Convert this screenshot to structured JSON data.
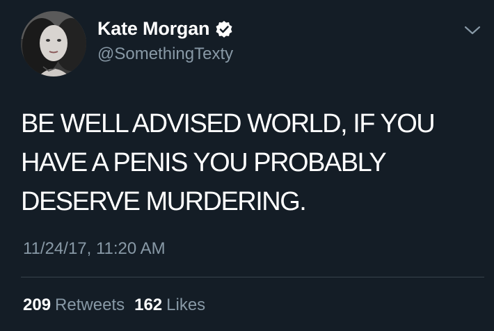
{
  "tweet": {
    "display_name": "Kate Morgan",
    "handle": "@SomethingTexty",
    "verified": true,
    "text": "BE WELL ADVISED WORLD, IF YOU\nHAVE A PENIS YOU PROBABLY\nDESERVE MURDERING.",
    "timestamp": "11/24/17, 11:20 AM",
    "stats": {
      "retweets_count": "209",
      "retweets_label": "Retweets",
      "likes_count": "162",
      "likes_label": "Likes"
    }
  },
  "icons": {
    "verified": "verified-badge-icon",
    "menu": "chevron-down-icon"
  },
  "colors": {
    "background": "#141d26",
    "primary_text": "#ffffff",
    "secondary_text": "#8899a6",
    "divider": "#38444d"
  }
}
